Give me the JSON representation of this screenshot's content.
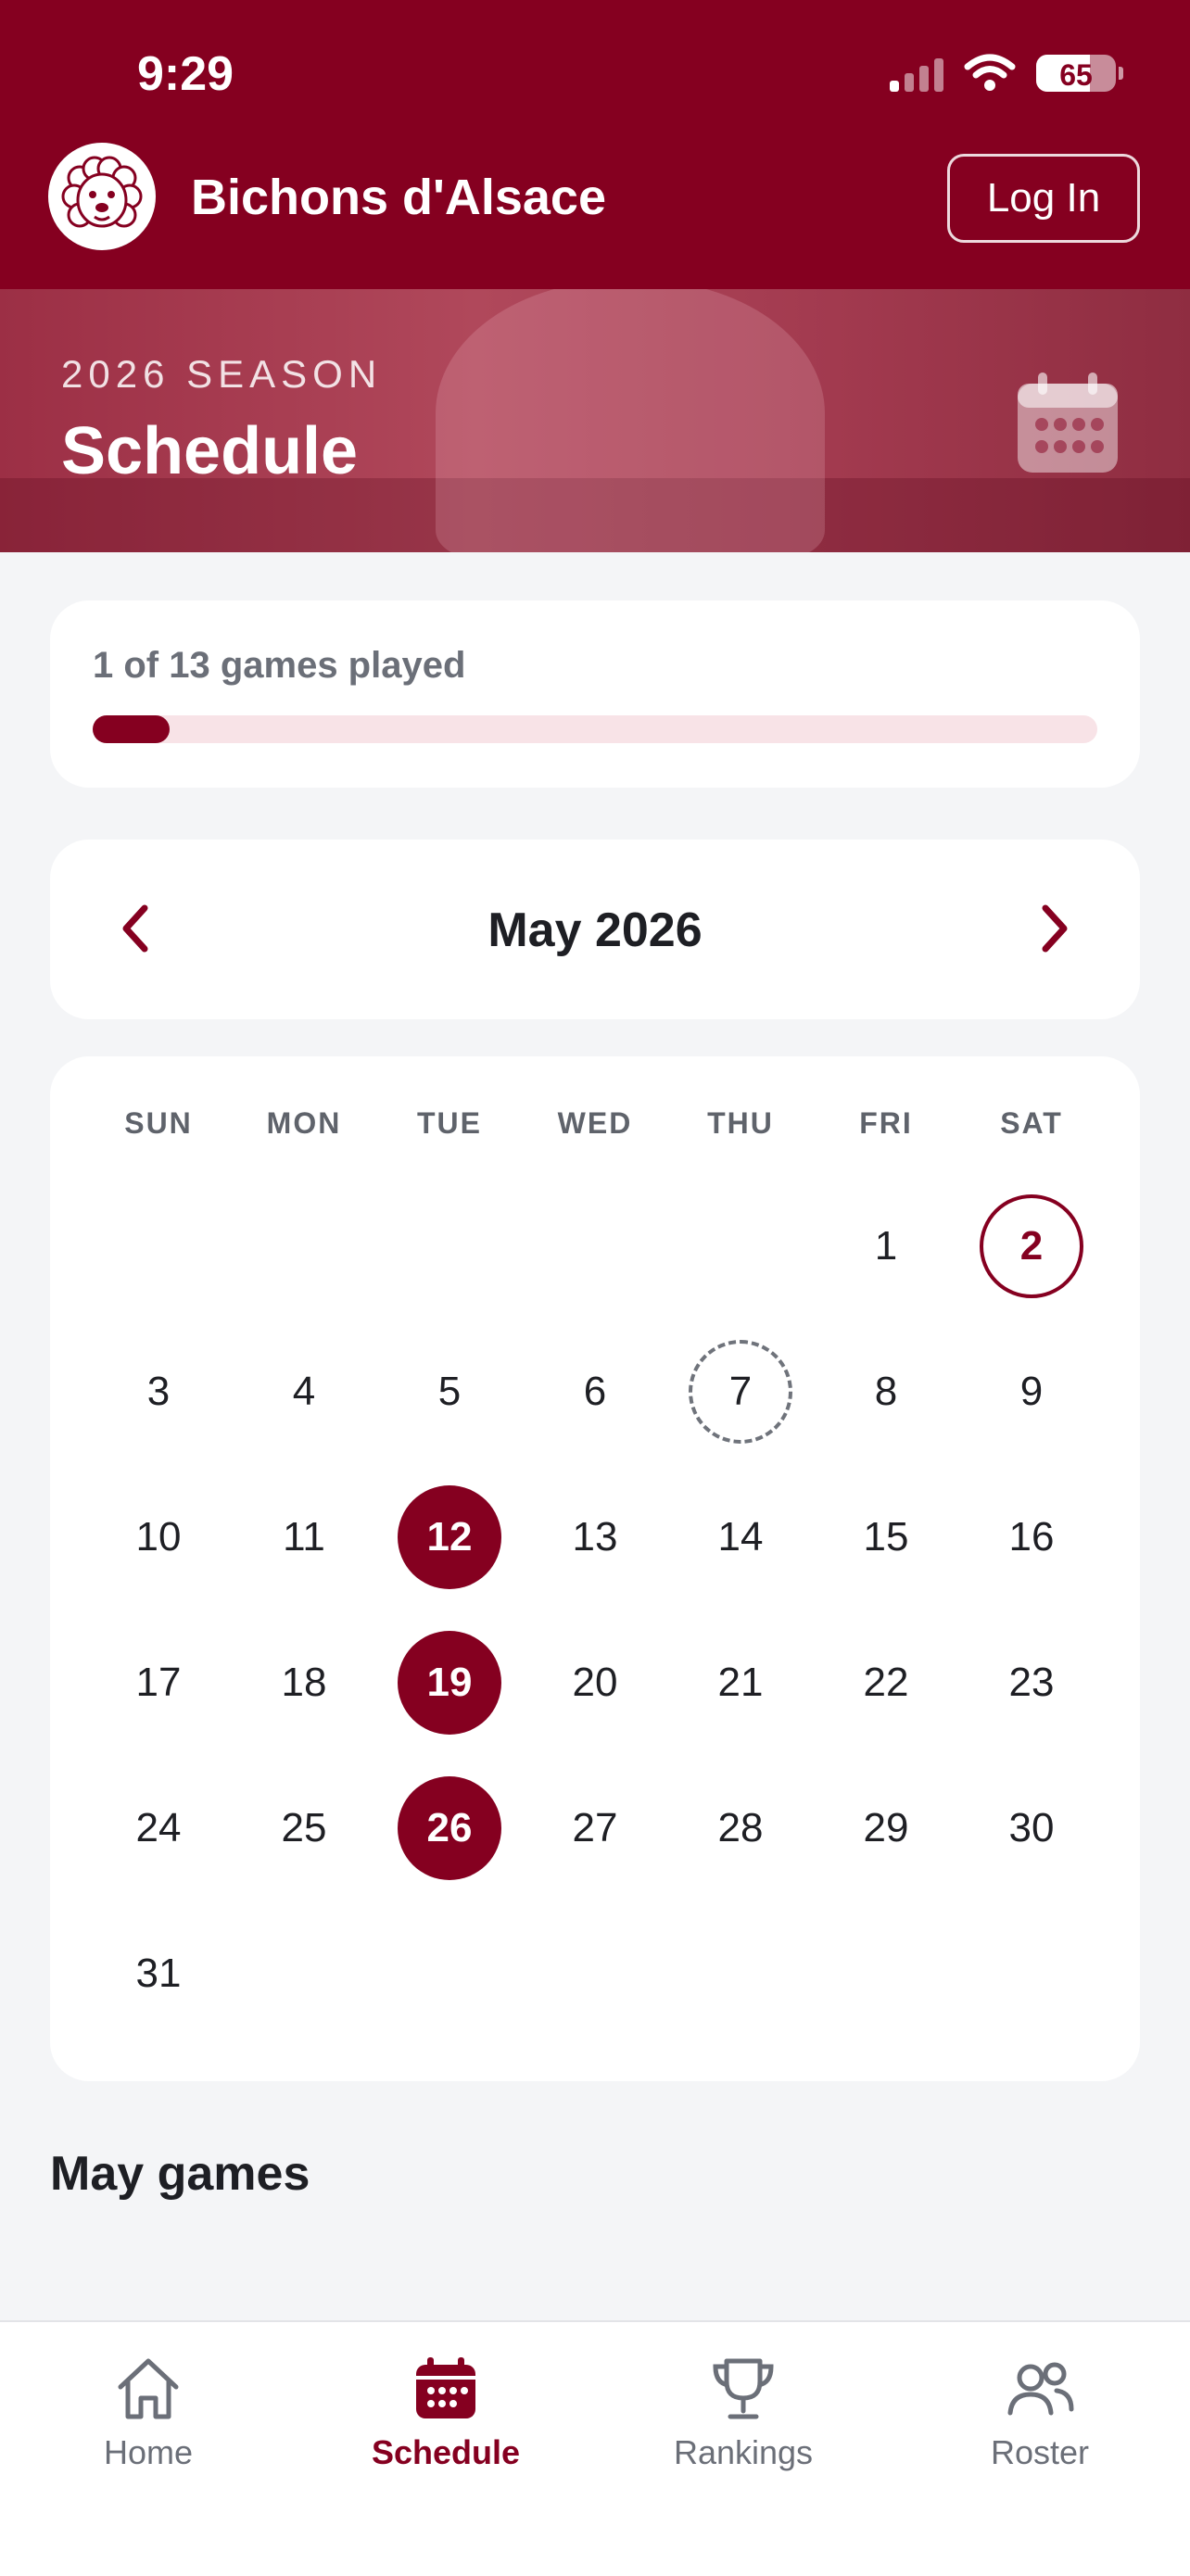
{
  "status_bar": {
    "time": "9:29",
    "battery": "65"
  },
  "header": {
    "app_title": "Bichons d'Alsace",
    "login_label": "Log In"
  },
  "hero": {
    "season_label": "2026 SEASON",
    "title": "Schedule"
  },
  "progress": {
    "text": "1 of 13 games played",
    "played": 1,
    "total": 13
  },
  "calendar": {
    "month_label": "May 2026",
    "weekdays": [
      "SUN",
      "MON",
      "TUE",
      "WED",
      "THU",
      "FRI",
      "SAT"
    ],
    "first_weekday_index": 5,
    "days_in_month": 31,
    "played_days": [
      2
    ],
    "upcoming_game_days": [
      12,
      19,
      26
    ],
    "today": 7
  },
  "games_section": {
    "title": "May games"
  },
  "tab_bar": {
    "items": [
      {
        "label": "Home",
        "icon": "home-icon",
        "active": false
      },
      {
        "label": "Schedule",
        "icon": "calendar-icon",
        "active": true
      },
      {
        "label": "Rankings",
        "icon": "trophy-icon",
        "active": false
      },
      {
        "label": "Roster",
        "icon": "people-icon",
        "active": false
      }
    ]
  },
  "colors": {
    "brand": "#850020",
    "progress_track": "#f8e3e7",
    "background": "#f4f5f7"
  }
}
